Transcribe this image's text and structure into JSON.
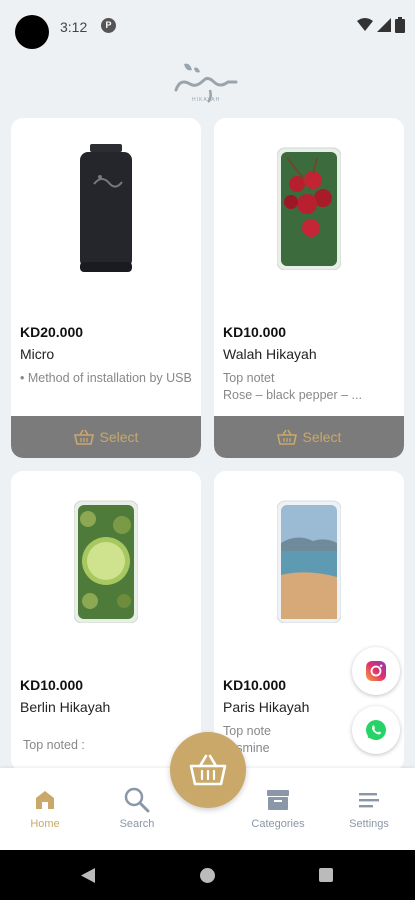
{
  "status_bar": {
    "time": "3:12",
    "app_icon": "P"
  },
  "header": {
    "logo_text": "حكاية",
    "logo_subtext": "HIKAYAH"
  },
  "products": [
    {
      "price": "KD20.000",
      "name": "Micro",
      "desc": "• Method of installation by USB",
      "select_label": "Select"
    },
    {
      "price": "KD10.000",
      "name": " Walah Hikayah",
      "desc": "Top notet\nRose – black pepper – ...",
      "select_label": "Select"
    },
    {
      "price": "KD10.000",
      "name": "Berlin Hikayah",
      "desc": "Top noted :"
    },
    {
      "price": "KD10.000",
      "name": "Paris Hikayah",
      "desc": "Top note\nJasmine"
    }
  ],
  "nav": [
    {
      "label": "Home",
      "icon": "home-icon",
      "active": true
    },
    {
      "label": "Search",
      "icon": "search-icon"
    },
    {
      "label": "Categories",
      "icon": "categories-icon"
    },
    {
      "label": "Settings",
      "icon": "settings-icon"
    }
  ],
  "colors": {
    "accent": "#c9a86a",
    "button_gray": "#7b7b7b",
    "background": "#eef1f4"
  }
}
